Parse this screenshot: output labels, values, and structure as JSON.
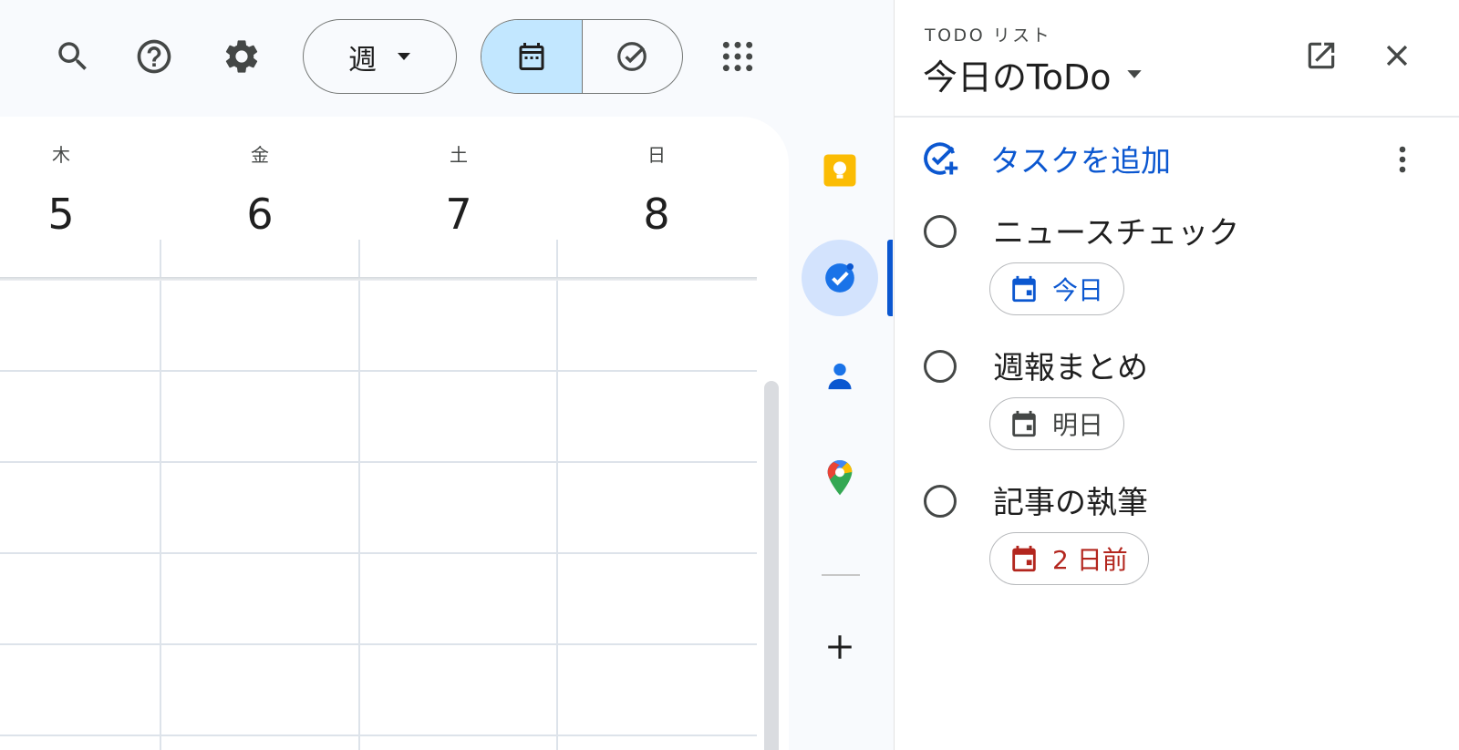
{
  "toolbar": {
    "search_icon": "search-icon",
    "help_icon": "help-icon",
    "settings_icon": "gear-icon",
    "view_select": {
      "label": "週"
    },
    "view_toggle": {
      "active": "calendar",
      "options": [
        "calendar",
        "tasks"
      ]
    },
    "apps_icon": "apps-grid-icon"
  },
  "calendar": {
    "days": [
      {
        "name": "木",
        "date": "5"
      },
      {
        "name": "金",
        "date": "6"
      },
      {
        "name": "土",
        "date": "7"
      },
      {
        "name": "日",
        "date": "8"
      }
    ]
  },
  "side_rail": {
    "items": [
      "keep-icon",
      "tasks-icon",
      "contacts-icon",
      "maps-icon",
      "add-icon"
    ],
    "active": "tasks-icon"
  },
  "tasks_panel": {
    "subtitle": "TODO リスト",
    "title": "今日のToDo",
    "add_task_label": "タスクを追加",
    "tasks": [
      {
        "title": "ニュースチェック",
        "due": "今日",
        "due_color": "#0b57d0"
      },
      {
        "title": "週報まとめ",
        "due": "明日",
        "due_color": "#444746"
      },
      {
        "title": "記事の執筆",
        "due": "2 日前",
        "due_color": "#b3261e"
      }
    ]
  },
  "colors": {
    "accent": "#0b57d0",
    "active_bg": "#c2e7ff",
    "rail_active_bg": "#d3e3fd",
    "overdue": "#b3261e"
  }
}
